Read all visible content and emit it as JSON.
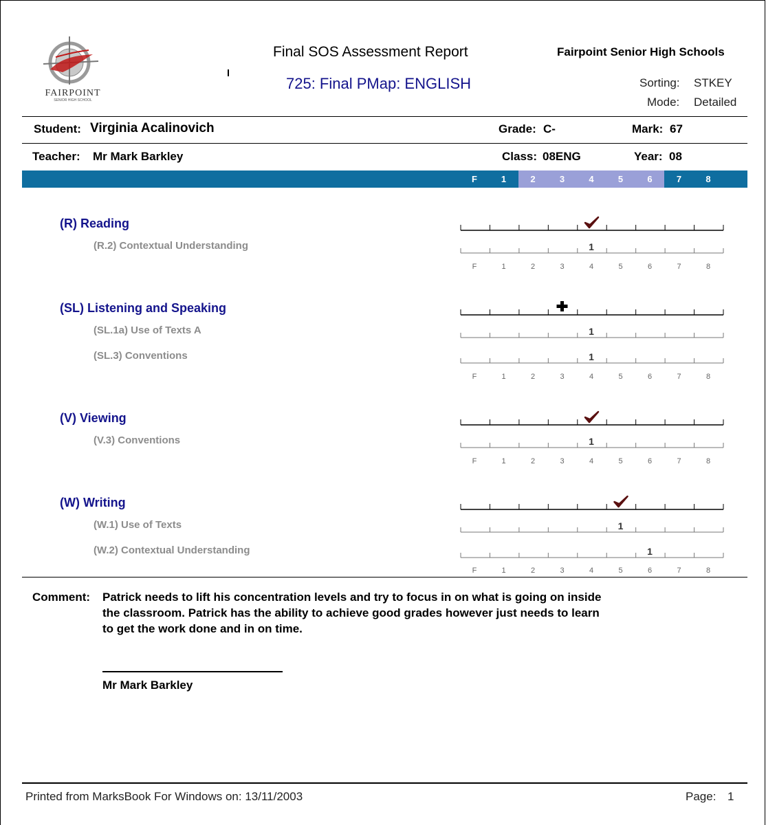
{
  "header": {
    "logo_text": "FAIRPOINT",
    "logo_subtext": "SENIOR HIGH SCHOOL",
    "report_title": "Final SOS Assessment Report",
    "school_name": "Fairpoint Senior High Schools",
    "report_subtitle": "725: Final PMap: ENGLISH",
    "sorting_label": "Sorting:",
    "sorting_value": "STKEY",
    "mode_label": "Mode:",
    "mode_value": "Detailed"
  },
  "student_info": {
    "student_label": "Student:",
    "student_name": "Virginia Acalinovich",
    "grade_label": "Grade:",
    "grade_value": "C-",
    "mark_label": "Mark:",
    "mark_value": "67",
    "teacher_label": "Teacher:",
    "teacher_name": "Mr Mark Barkley",
    "class_label": "Class:",
    "class_value": "08ENG",
    "year_label": "Year:",
    "year_value": "08"
  },
  "level_band": {
    "labels": [
      "F",
      "1",
      "2",
      "3",
      "4",
      "5",
      "6",
      "7",
      "8"
    ],
    "highlighted_range": [
      "2",
      "6"
    ],
    "colors": {
      "band": "#0f6ea0",
      "highlight": "#9aa0d8"
    }
  },
  "scale_labels": [
    "F",
    "1",
    "2",
    "3",
    "4",
    "5",
    "6",
    "7",
    "8"
  ],
  "strands": [
    {
      "title": "(R) Reading",
      "level": "4",
      "marker": "check",
      "outcomes": [
        {
          "title": "(R.2) Contextual Understanding",
          "level": "4",
          "value": "1"
        }
      ]
    },
    {
      "title": "(SL) Listening and Speaking",
      "level": "3",
      "marker": "plus",
      "outcomes": [
        {
          "title": "(SL.1a) Use of Texts A",
          "level": "4",
          "value": "1"
        },
        {
          "title": "(SL.3) Conventions",
          "level": "4",
          "value": "1"
        }
      ]
    },
    {
      "title": "(V) Viewing",
      "level": "4",
      "marker": "check",
      "outcomes": [
        {
          "title": "(V.3) Conventions",
          "level": "4",
          "value": "1"
        }
      ]
    },
    {
      "title": "(W) Writing",
      "level": "5",
      "marker": "check",
      "outcomes": [
        {
          "title": "(W.1) Use of Texts",
          "level": "5",
          "value": "1"
        },
        {
          "title": "(W.2) Contextual Understanding",
          "level": "6",
          "value": "1"
        }
      ]
    }
  ],
  "comment": {
    "label": "Comment:",
    "lines": [
      "Patrick needs to lift his concentration levels and try to focus in on what is going on inside",
      "the classroom. Patrick has the ability to achieve good grades however just needs to learn",
      "to get the work done and in on time."
    ],
    "signature_name": "Mr Mark Barkley"
  },
  "footer": {
    "printed_from": "Printed from MarksBook For Windows on:  13/11/2003",
    "page_label": "Page:",
    "page_number": "1"
  }
}
